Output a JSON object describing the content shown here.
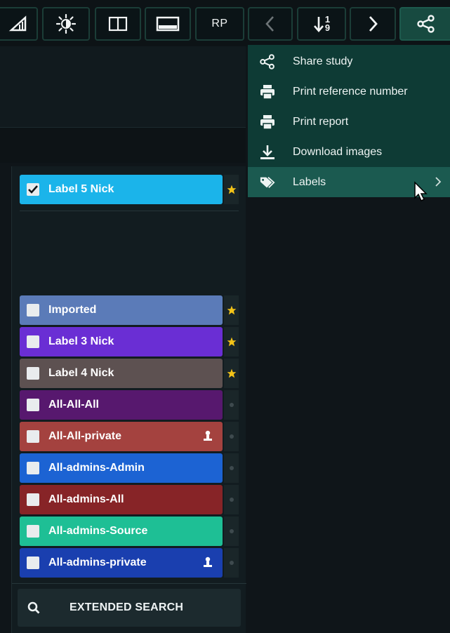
{
  "toolbar": {
    "rp_label": "RP",
    "buttons": [
      "measure-icon",
      "brightness-icon",
      "split-view-icon",
      "monitor-icon",
      "RP",
      "chevron-left-icon",
      "sort-order-icon",
      "chevron-right-icon",
      "share-icon"
    ],
    "sort_top": "1",
    "sort_bottom": "9"
  },
  "menu": {
    "items": [
      {
        "label": "Share study",
        "icon": "share-icon"
      },
      {
        "label": "Print reference number",
        "icon": "printer-icon"
      },
      {
        "label": "Print report",
        "icon": "printer-icon"
      },
      {
        "label": "Download images",
        "icon": "download-icon"
      },
      {
        "label": "Labels",
        "icon": "tag-icon",
        "submenu": true
      }
    ]
  },
  "labels": {
    "active": [
      {
        "name": "Label 5 Nick",
        "color": "#1bb4ea",
        "checked": true,
        "starred": true
      }
    ],
    "list": [
      {
        "name": "Imported",
        "color": "#5b7bb8",
        "checked": false,
        "marker": "star"
      },
      {
        "name": "Label 3 Nick",
        "color": "#6a2ed4",
        "checked": false,
        "marker": "star"
      },
      {
        "name": "Label 4 Nick",
        "color": "#5d5151",
        "checked": false,
        "marker": "star"
      },
      {
        "name": "All-All-All",
        "color": "#57186e",
        "checked": false,
        "marker": "dot"
      },
      {
        "name": "All-All-private",
        "color": "#a4423f",
        "checked": false,
        "marker": "dot",
        "private": true
      },
      {
        "name": "All-admins-Admin",
        "color": "#1c63d3",
        "checked": false,
        "marker": "dot"
      },
      {
        "name": "All-admins-All",
        "color": "#872427",
        "checked": false,
        "marker": "dot"
      },
      {
        "name": "All-admins-Source",
        "color": "#1ebf95",
        "checked": false,
        "marker": "dot"
      },
      {
        "name": "All-admins-private",
        "color": "#1a3faf",
        "checked": false,
        "marker": "dot",
        "private": true
      }
    ],
    "colors": {
      "star": "#f3c318",
      "panel": "#121c20"
    }
  },
  "search": {
    "label": "EXTENDED SEARCH",
    "icon": "search-icon"
  }
}
